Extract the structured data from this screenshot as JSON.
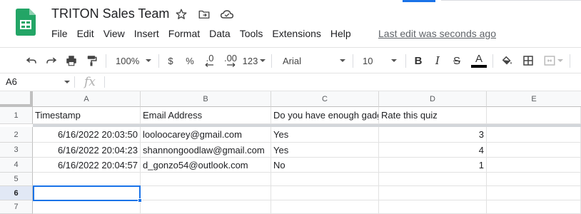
{
  "doc": {
    "title": "TRITON Sales Team",
    "last_edit": "Last edit was seconds ago"
  },
  "menu": [
    "File",
    "Edit",
    "View",
    "Insert",
    "Format",
    "Data",
    "Tools",
    "Extensions",
    "Help"
  ],
  "toolbar": {
    "zoom": "100%",
    "currency": "$",
    "percent": "%",
    "dec_decrease": ".0",
    "dec_increase": ".00",
    "more_formats": "123",
    "font": "Arial",
    "font_size": "10",
    "bold": "B",
    "italic": "I",
    "strike": "S",
    "text_color_letter": "A"
  },
  "formula_bar": {
    "cell_ref": "A6",
    "fx": "fx"
  },
  "columns": [
    "A",
    "B",
    "C",
    "D",
    "E"
  ],
  "rows": [
    "1",
    "2",
    "3",
    "4",
    "5",
    "6",
    "7"
  ],
  "sheet": {
    "header": [
      "Timestamp",
      "Email Address",
      "Do you have enough gadgets for your",
      "Rate this quiz"
    ],
    "data": [
      [
        "6/16/2022 20:03:50",
        "looloocarey@gmail.com",
        "Yes",
        "3"
      ],
      [
        "6/16/2022 20:04:23",
        "shannongoodlaw@gmail.com",
        "Yes",
        "4"
      ],
      [
        "6/16/2022 20:04:57",
        "d_gonzo54@outlook.com",
        "No",
        "1"
      ]
    ]
  },
  "icons": {
    "logo": "sheets-logo-icon",
    "star": "star-icon",
    "move": "move-to-folder-icon",
    "cloud": "cloud-status-icon"
  },
  "colors": {
    "brand": "#23a566",
    "accent": "#1a73e8",
    "header_bg": "#f8f9fa",
    "selected_row_header": "#e1e8f5"
  }
}
